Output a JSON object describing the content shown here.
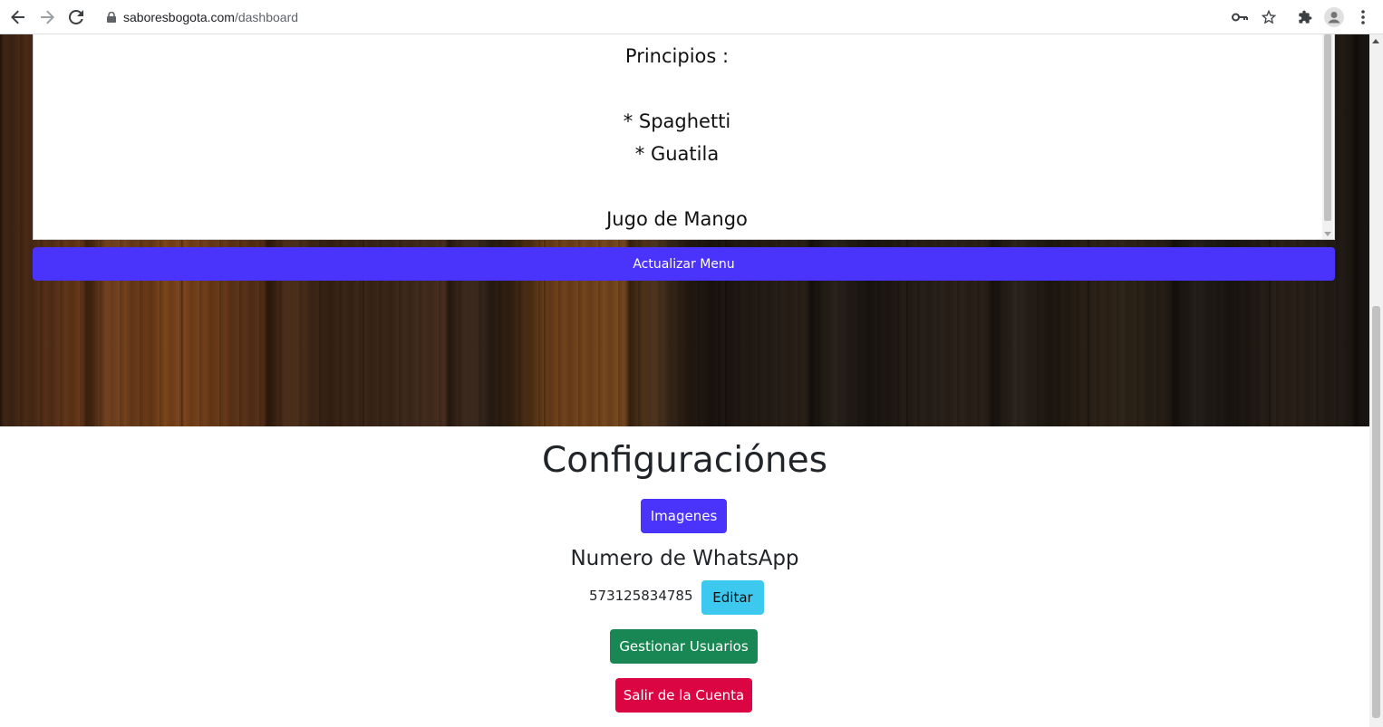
{
  "browser": {
    "url_host": "saboresbogota.com",
    "url_path": "/dashboard"
  },
  "menu": {
    "lines": [
      "Principios :",
      "* Spaghetti",
      "* Guatila",
      "Jugo de Mango"
    ],
    "update_button": "Actualizar Menu"
  },
  "config": {
    "title": "Configuraciónes",
    "images_button": "Imagenes",
    "whatsapp_title": "Numero de WhatsApp",
    "whatsapp_number": "573125834785",
    "edit_button": "Editar",
    "users_button": "Gestionar Usuarios",
    "logout_button": "Salir de la Cuenta"
  },
  "colors": {
    "primary": "#4a33fb",
    "info": "#3dc8ef",
    "success": "#198754",
    "danger": "#dc0544"
  }
}
